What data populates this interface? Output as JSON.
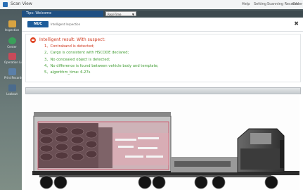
{
  "titlebar": {
    "app_title": "Scan View",
    "menu": [
      "Help",
      "Setting",
      "Scanning Records",
      "Order"
    ]
  },
  "desktop_icons": [
    {
      "label": "Inspection",
      "color": "#d9a441"
    },
    {
      "label": "Center",
      "color": "#3aa05a"
    },
    {
      "label": "Operation List",
      "color": "#c94a59"
    },
    {
      "label": "Print Records",
      "color": "#5a7fa8"
    },
    {
      "label": "Lookout",
      "color": "#4b6b8c"
    }
  ],
  "tabs": {
    "active": "Tips: Welcome",
    "select_value": "Real-Time Inspection"
  },
  "window": {
    "logo_text": "NUC",
    "subtitle": "Intelligent Inspection",
    "close_symbol": "✖"
  },
  "result": {
    "title": "Intelligent result: With suspect:",
    "items": [
      {
        "text": "1、Contraband is detected;",
        "status": "red"
      },
      {
        "text": "2、Cargo is consistent with HSCODE declared;",
        "status": "green"
      },
      {
        "text": "3、No concealed object is detected;",
        "status": "green"
      },
      {
        "text": "4、No difference is found between vehicle body and template;",
        "status": "green"
      },
      {
        "text": "5、algorithm_time: 6.27s",
        "status": "green"
      }
    ]
  },
  "colors": {
    "alert_red": "#d0391f",
    "ok_green": "#3c9a2e",
    "tab_blue": "#1f4f82"
  }
}
